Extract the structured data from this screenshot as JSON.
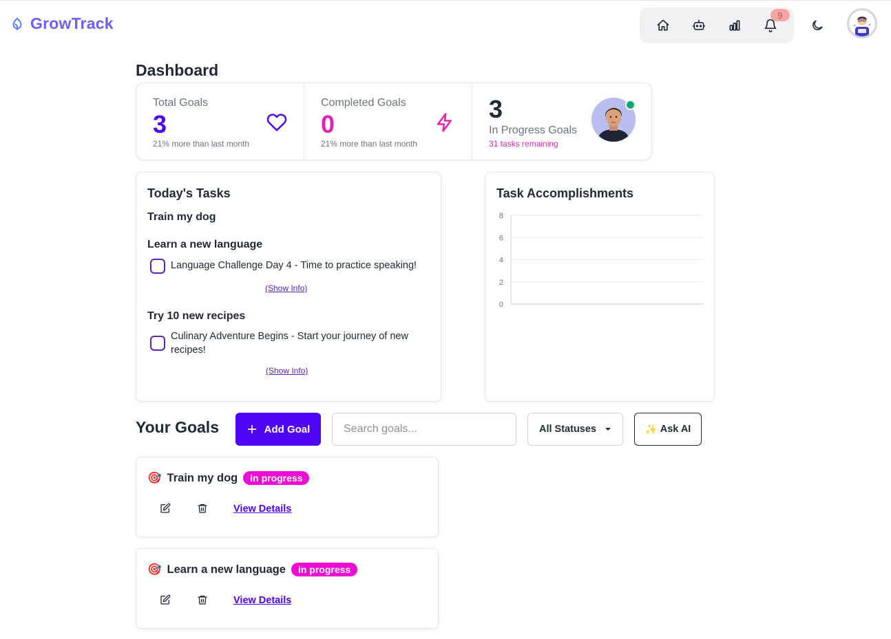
{
  "header": {
    "app_name": "GrowTrack",
    "notification_count": "9",
    "nav_icons": [
      "home-icon",
      "bot-icon",
      "chart-icon",
      "bell-icon"
    ],
    "theme_icon": "moon-icon"
  },
  "dashboard": {
    "title": "Dashboard"
  },
  "stats": {
    "total_goals": {
      "label": "Total Goals",
      "value": "3",
      "desc": "21% more than last month",
      "icon": "heart-icon",
      "color": "#4f04f5"
    },
    "completed_goals": {
      "label": "Completed Goals",
      "value": "0",
      "desc": "21% more than last month",
      "icon": "bolt-icon",
      "color": "#e91eb8"
    },
    "in_progress": {
      "value": "3",
      "label": "In Progress Goals",
      "desc": "31 tasks remaining"
    }
  },
  "tasks": {
    "title": "Today's Tasks",
    "groups": [
      {
        "goal": "Train my dog",
        "items": []
      },
      {
        "goal": "Learn a new language",
        "items": [
          {
            "text": "Language Challenge Day 4 - Time to practice speaking!",
            "show_info": "(Show Info)"
          }
        ]
      },
      {
        "goal": "Try 10 new recipes",
        "items": [
          {
            "text": "Culinary Adventure Begins - Start your journey of new recipes!",
            "show_info": "(Show Info)"
          }
        ]
      }
    ]
  },
  "accomplishments": {
    "title": "Task Accomplishments"
  },
  "chart_data": {
    "type": "bar",
    "title": "",
    "categories": [],
    "values": [],
    "ylim": [
      0,
      8
    ],
    "yticks": [
      "8",
      "6",
      "4",
      "2",
      "0"
    ],
    "grid": true
  },
  "goals": {
    "title": "Your Goals",
    "add_label": "Add Goal",
    "search_placeholder": "Search goals...",
    "status_filter": "All Statuses",
    "ask_ai_label": "Ask AI",
    "ask_ai_emoji": "✨",
    "items": [
      {
        "emoji": "🎯",
        "title": "Train my dog",
        "status": "in progress",
        "link": "View Details"
      },
      {
        "emoji": "🎯",
        "title": "Learn a new language",
        "status": "in progress",
        "link": "View Details"
      }
    ]
  },
  "colors": {
    "primary": "#4f04f5",
    "accent_pink": "#f00ad5",
    "online": "#12a671"
  }
}
